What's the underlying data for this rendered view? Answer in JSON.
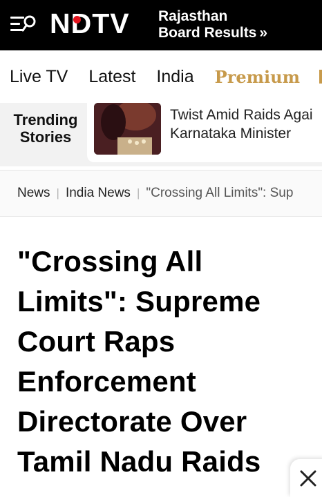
{
  "header": {
    "logo_text": "NDTV",
    "promo_line1": "Rajasthan",
    "promo_line2": "Board Results",
    "promo_arrow": "»",
    "colors": {
      "background": "#000000",
      "logo": "#ffffff",
      "accent_dot": "#e4131d"
    }
  },
  "nav": {
    "items": [
      {
        "label": "Live TV"
      },
      {
        "label": "Latest"
      },
      {
        "label": "India"
      },
      {
        "label": "Premium"
      }
    ],
    "premium_color": "#c79a4b"
  },
  "trending": {
    "label": "Trending Stories",
    "story_line1": "Twist Amid Raids Agai",
    "story_line2": "Karnataka Minister"
  },
  "breadcrumb": {
    "items": [
      {
        "label": "News"
      },
      {
        "label": "India News"
      },
      {
        "label": "\"Crossing All Limits\": Sup"
      }
    ]
  },
  "article": {
    "headline": "\"Crossing All Limits\": Supreme Court Raps Enforcement Directorate Over Tamil Nadu Raids"
  },
  "icons": {
    "menu": "menu-search-icon",
    "close": "close-icon"
  }
}
